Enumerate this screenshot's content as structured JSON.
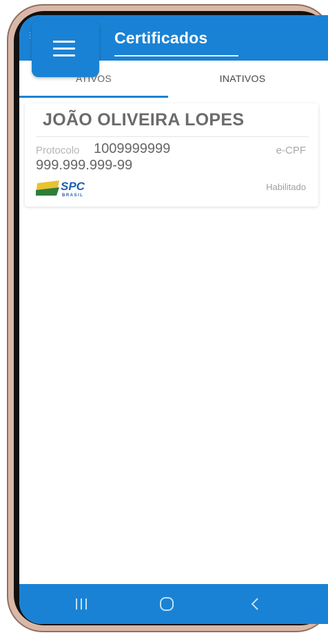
{
  "app": {
    "title": "Certificados"
  },
  "tabs": [
    {
      "label": "ATIVOS",
      "active": true
    },
    {
      "label": "INATIVOS",
      "active": false
    }
  ],
  "certificate": {
    "name": "JOÃO OLIVEIRA LOPES",
    "protocol_label": "Protocolo",
    "protocol_value": "1009999999",
    "type": "e-CPF",
    "cpf": "999.999.999-99",
    "issuer_logo": "SPC BRASIL",
    "status": "Habilitado"
  },
  "colors": {
    "primary": "#1a82d4",
    "frame": "#d9b8a8"
  },
  "icons": {
    "menu": "hamburger-menu-icon",
    "recents": "recents-icon",
    "home": "home-icon",
    "back": "back-icon"
  }
}
